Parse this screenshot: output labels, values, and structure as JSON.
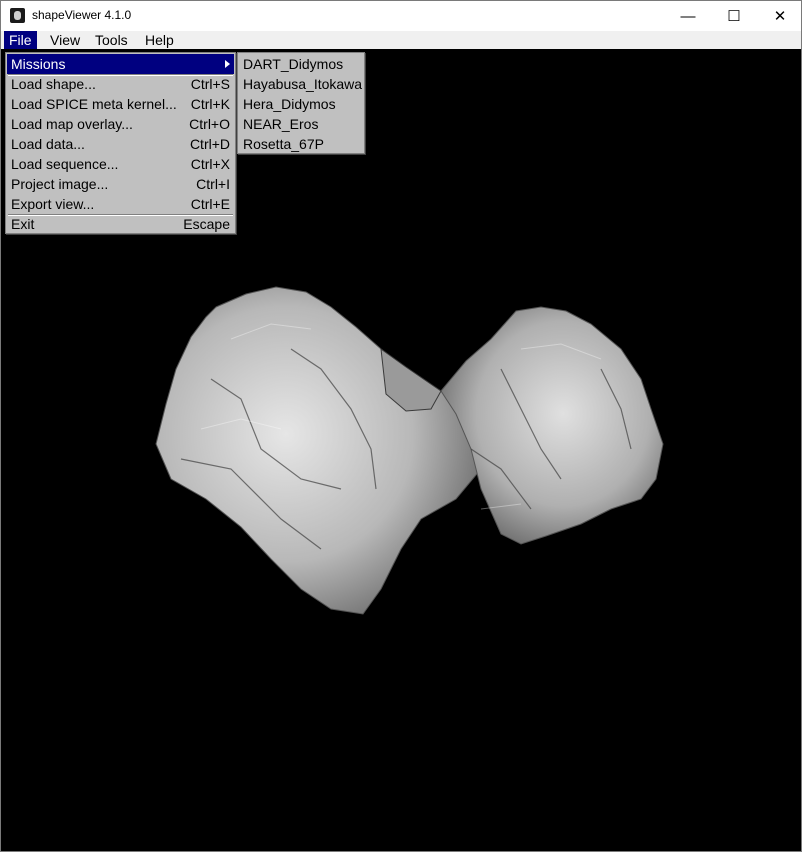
{
  "window": {
    "title": "shapeViewer 4.1.0",
    "controls": {
      "minimize": "—",
      "maximize": "☐",
      "close": "✕"
    }
  },
  "menubar": {
    "items": [
      "File",
      "View",
      "Tools",
      "Help"
    ]
  },
  "file_menu": {
    "items": [
      {
        "label": "Missions",
        "shortcut": ""
      },
      {
        "label": "Load shape...",
        "shortcut": "Ctrl+S"
      },
      {
        "label": "Load SPICE meta kernel...",
        "shortcut": "Ctrl+K"
      },
      {
        "label": "Load map overlay...",
        "shortcut": "Ctrl+O"
      },
      {
        "label": "Load data...",
        "shortcut": "Ctrl+D"
      },
      {
        "label": "Load sequence...",
        "shortcut": "Ctrl+X"
      },
      {
        "label": "Project image...",
        "shortcut": "Ctrl+I"
      },
      {
        "label": "Export view...",
        "shortcut": "Ctrl+E"
      },
      {
        "label": "Exit",
        "shortcut": "Escape"
      }
    ]
  },
  "missions_submenu": {
    "items": [
      "DART_Didymos",
      "Hayabusa_Itokawa",
      "Hera_Didymos",
      "NEAR_Eros",
      "Rosetta_67P"
    ]
  },
  "colors": {
    "menu_highlight": "#000080",
    "menu_bg": "#c0c0c0",
    "viewport_bg": "#000000",
    "comet": "#c8c8c8"
  },
  "icons": {
    "app": "shapeviewer-app-icon",
    "submenu_arrow": "chevron-right-icon"
  }
}
